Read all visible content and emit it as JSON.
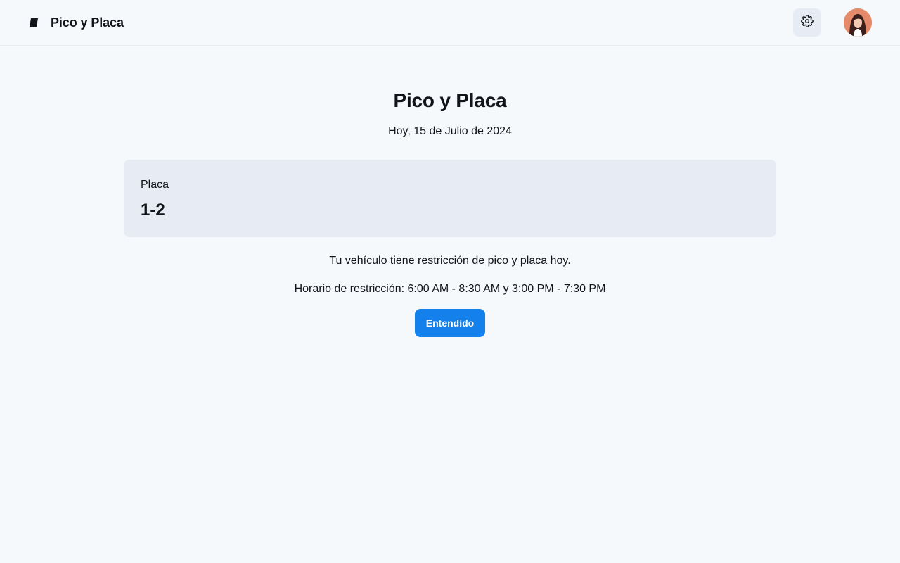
{
  "header": {
    "logo_icon": "traffic-sign-icon",
    "brand_title": "Pico y Placa",
    "settings_icon": "gear-icon",
    "avatar_icon": "user-avatar"
  },
  "main": {
    "title": "Pico y Placa",
    "date": "Hoy, 15 de Julio de 2024",
    "plate": {
      "label": "Placa",
      "value": "1-2"
    },
    "restriction_message": "Tu vehículo tiene restricción de pico y placa hoy.",
    "schedule": "Horario de restricción: 6:00 AM - 8:30 AM y 3:00 PM - 7:30 PM",
    "confirm_button": "Entendido"
  },
  "colors": {
    "background": "#f5f9fc",
    "card": "#e7ebf3",
    "primary": "#1380ec",
    "text": "#111418"
  }
}
